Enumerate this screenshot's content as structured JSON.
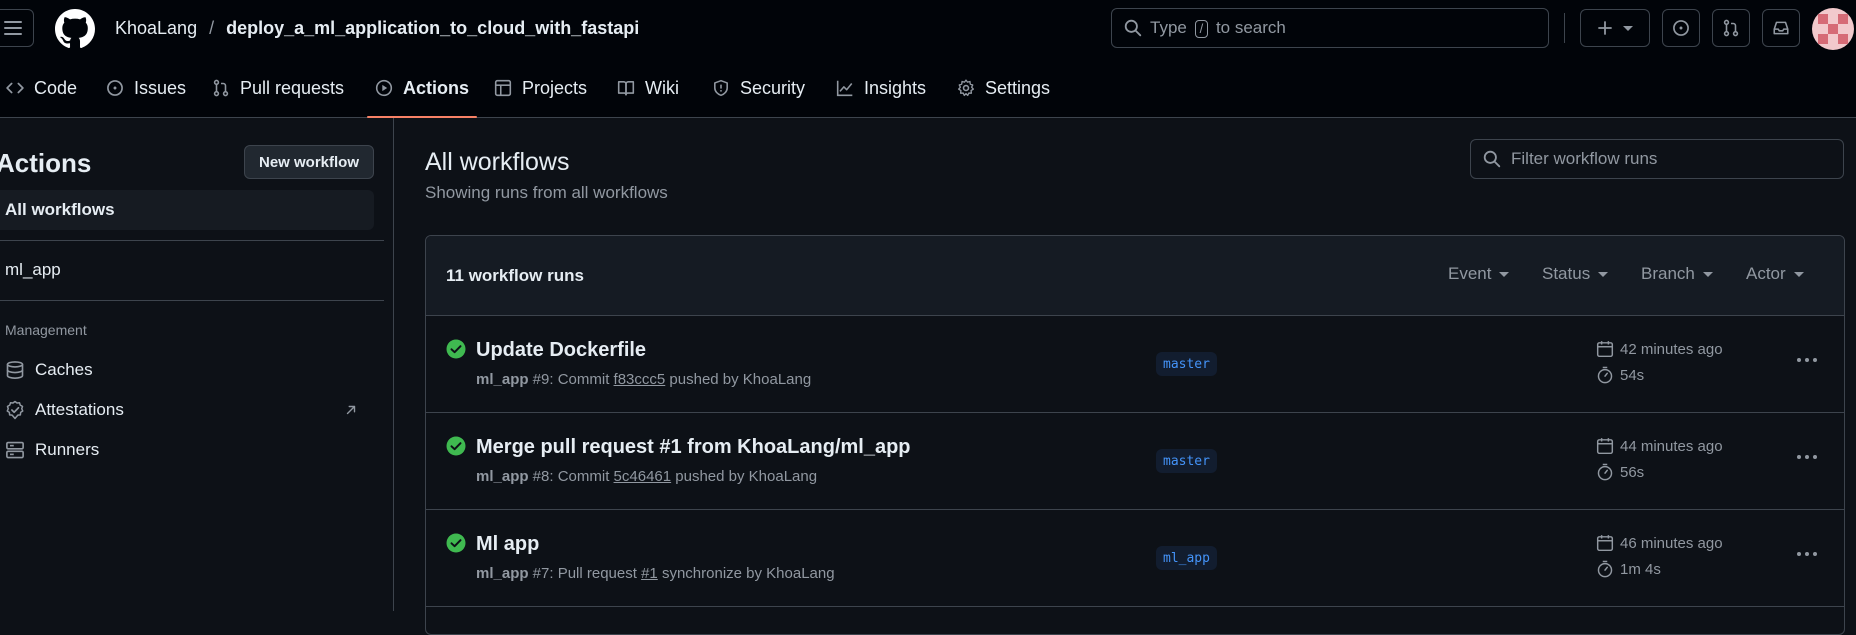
{
  "header": {
    "owner": "KhoaLang",
    "separator": "/",
    "repo": "deploy_a_ml_application_to_cloud_with_fastapi",
    "search_prefix": "Type",
    "search_key": "/",
    "search_suffix": "to search"
  },
  "repo_nav": {
    "items": [
      {
        "label": "Code",
        "icon": "code-icon"
      },
      {
        "label": "Issues",
        "icon": "issue-icon"
      },
      {
        "label": "Pull requests",
        "icon": "pull-request-icon"
      },
      {
        "label": "Actions",
        "icon": "play-icon"
      },
      {
        "label": "Projects",
        "icon": "table-icon"
      },
      {
        "label": "Wiki",
        "icon": "book-icon"
      },
      {
        "label": "Security",
        "icon": "shield-icon"
      },
      {
        "label": "Insights",
        "icon": "graph-icon"
      },
      {
        "label": "Settings",
        "icon": "gear-icon"
      }
    ],
    "active": "Actions"
  },
  "sidebar": {
    "title": "Actions",
    "new_workflow": "New workflow",
    "all_workflows": "All workflows",
    "workflows": [
      "ml_app"
    ],
    "management_label": "Management",
    "management": [
      {
        "label": "Caches",
        "icon": "cache-icon"
      },
      {
        "label": "Attestations",
        "icon": "check-circle-icon"
      },
      {
        "label": "Runners",
        "icon": "server-icon"
      }
    ]
  },
  "main": {
    "title": "All workflows",
    "subtitle": "Showing runs from all workflows",
    "filter_placeholder": "Filter workflow runs",
    "runs_count": "11 workflow runs",
    "filters": [
      "Event",
      "Status",
      "Branch",
      "Actor"
    ],
    "runs": [
      {
        "status": "success",
        "title": "Update Dockerfile",
        "workflow": "ml_app",
        "meta_mid": " #9: Commit ",
        "ref": "f83ccc5",
        "meta_end": " pushed by KhoaLang",
        "branch": "master",
        "time": "42 minutes ago",
        "duration": "54s"
      },
      {
        "status": "success",
        "title": "Merge pull request #1 from KhoaLang/ml_app",
        "workflow": "ml_app",
        "meta_mid": " #8: Commit ",
        "ref": "5c46461",
        "meta_end": " pushed by KhoaLang",
        "branch": "master",
        "time": "44 minutes ago",
        "duration": "56s"
      },
      {
        "status": "success",
        "title": "Ml app",
        "workflow": "ml_app",
        "meta_mid": " #7: Pull request ",
        "ref": "#1",
        "meta_end": " synchronize by KhoaLang",
        "branch": "ml_app",
        "time": "46 minutes ago",
        "duration": "1m 4s"
      }
    ]
  },
  "colors": {
    "background": "#0d1117",
    "header_bg": "#010409",
    "accent_underline": "#f78166",
    "success": "#3fb950",
    "branch_text": "#4493f8"
  }
}
